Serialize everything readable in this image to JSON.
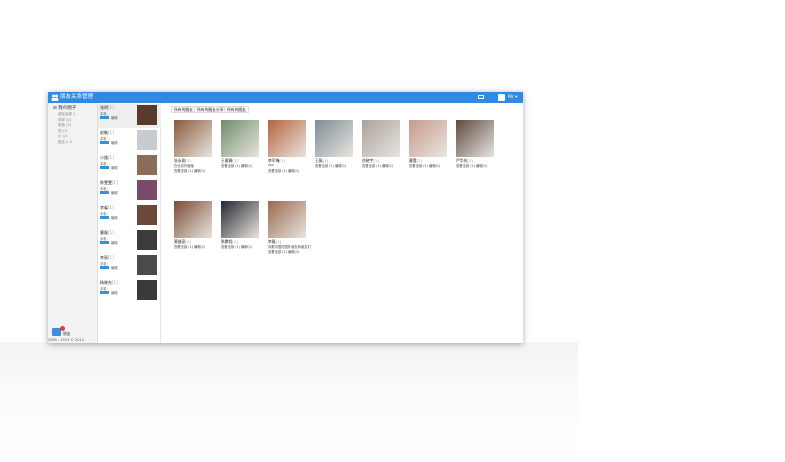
{
  "window": {
    "title": "朋友关系管理",
    "user": "Mr ▾"
  },
  "sidebar": {
    "group_title": "⊟ 我の圈子",
    "items": [
      "朋友全部 1",
      "同学 (5)",
      "家族 (5)",
      "同 (1)",
      "小 (2)",
      "陌生人 5"
    ],
    "footer_label": "朋友",
    "copyright": "2009 - 2013 © 2012"
  },
  "contacts": [
    {
      "name": "张明",
      "tag": "[1]",
      "phone": "手机:",
      "edit": "编辑"
    },
    {
      "name": "赵敏",
      "tag": "[1]",
      "phone": "手机:",
      "edit": "编辑"
    },
    {
      "name": "小路",
      "tag": "[1]",
      "phone": "手机:",
      "edit": "编辑"
    },
    {
      "name": "陈雯雯",
      "tag": "[1]",
      "phone": "手机:",
      "edit": "编辑"
    },
    {
      "name": "李淼",
      "tag": "[1]",
      "phone": "手机:",
      "edit": "编辑"
    },
    {
      "name": "曹磊",
      "tag": "[1]",
      "phone": "手机:",
      "edit": "编辑"
    },
    {
      "name": "李丽",
      "tag": "[1]",
      "phone": "手机:",
      "edit": "编辑"
    },
    {
      "name": "杨晓东",
      "tag": "[1]",
      "phone": "手机:",
      "edit": "编辑"
    }
  ],
  "tabs": [
    "所有的圈友",
    "所有的圈友分享",
    "所有的圈友"
  ],
  "friends": [
    {
      "name": "张永刚",
      "status": "[1]",
      "line1": "在北京外面跑",
      "line2": "查看全部 (1) 编辑(1)",
      "color": "#8a5a3c"
    },
    {
      "name": "王雅静",
      "status": "[1]",
      "line1": "查看全部 (1) 编辑(1)",
      "line2": "",
      "color": "#6f8f6a"
    },
    {
      "name": "李军锋",
      "status": "[1]",
      "line1": "xxx",
      "line2": "查看全部 (1) 编辑(1)",
      "color": "#b5643e"
    },
    {
      "name": "王磊",
      "status": "[1]",
      "line1": "查看全部 (1) 编辑(1)",
      "line2": "",
      "color": "#7f8c96"
    },
    {
      "name": "徐晓宇",
      "status": "[1]",
      "line1": "查看全部 (1) 编辑(1)",
      "line2": "",
      "color": "#a9a39a"
    },
    {
      "name": "曹霞",
      "status": "[1]",
      "line1": "查看全部 (1) 编辑(1)",
      "line2": "",
      "color": "#c79b8b"
    },
    {
      "name": "严华庆",
      "status": "[1]",
      "line1": "查看全部 (1) 编辑(1)",
      "line2": "",
      "color": "#5d4a40"
    },
    {
      "name": "黄骏豪",
      "status": "[1]",
      "line1": "查看全部 (1) 编辑(1)",
      "line2": "",
      "color": "#7a4d35"
    },
    {
      "name": "陈鹏程",
      "status": "[1]",
      "line1": "查看全部 (1) 编辑(1)",
      "line2": "",
      "color": "#232730"
    },
    {
      "name": "李磊",
      "status": "[1]",
      "line1": "你跟中国的国外朋友和朋友们",
      "line2": "查看全部 (1) 编辑(1)",
      "color": "#9a6a50"
    }
  ],
  "colors": {
    "accent": "#2f8ae5",
    "button": "#2b95d8"
  }
}
